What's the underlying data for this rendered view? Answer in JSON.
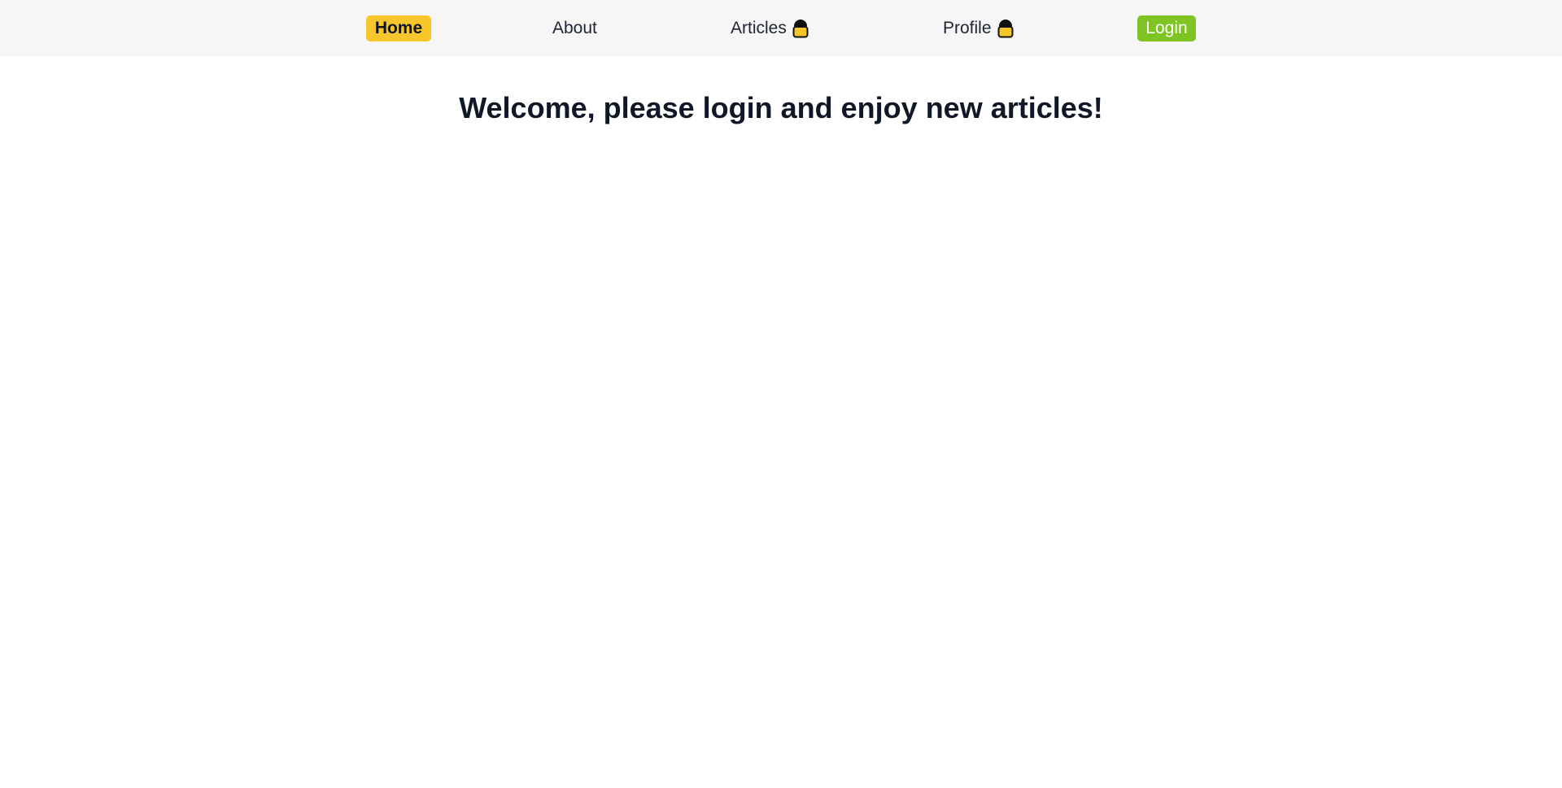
{
  "nav": {
    "items": [
      {
        "label": "Home",
        "active": true
      },
      {
        "label": "About"
      },
      {
        "label": "Articles",
        "icon": "lock-icon"
      },
      {
        "label": "Profile",
        "icon": "lock-icon"
      },
      {
        "label": "Login"
      }
    ]
  },
  "main": {
    "title": "Welcome, please login and enjoy new articles!"
  },
  "colors": {
    "navbar_bg": "#f6f6f6",
    "home_highlight": "#f7c62a",
    "login_button": "#7ec422",
    "lock_fill": "#f7c62a",
    "text_dark": "#101828"
  }
}
